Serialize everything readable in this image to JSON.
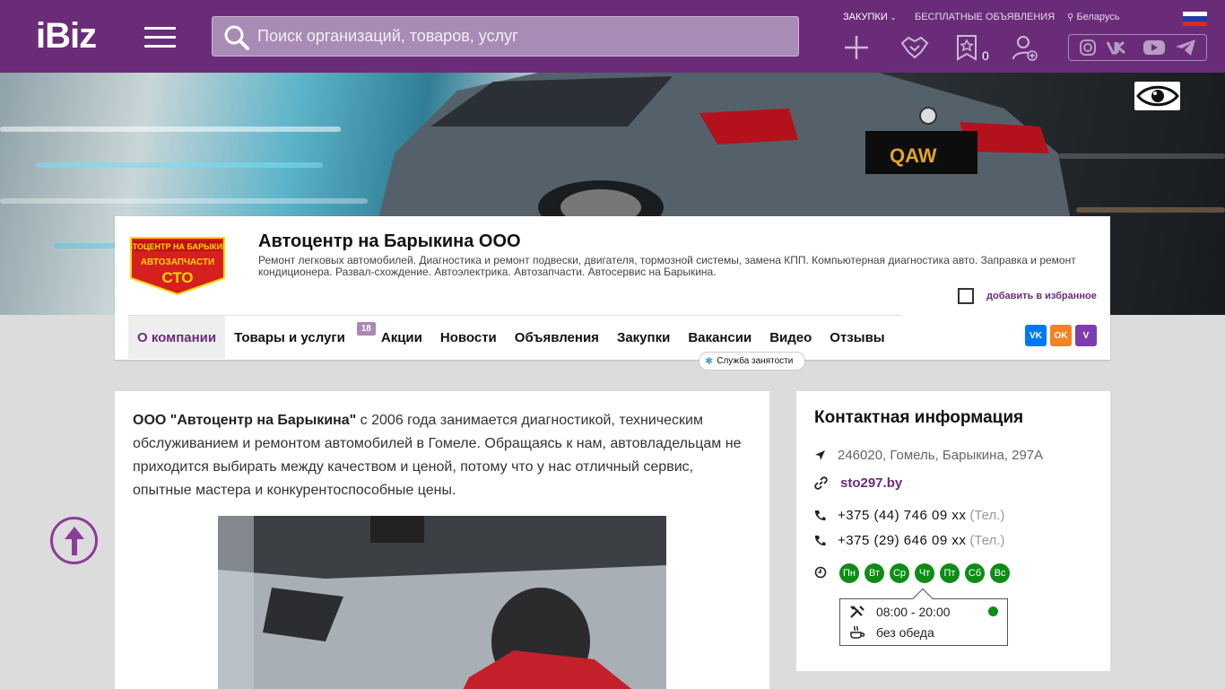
{
  "header": {
    "logo": "iBiz",
    "search_placeholder": "Поиск организаций, товаров, услуг",
    "links": {
      "purchases": "ЗАКУПКИ",
      "free_ads": "БЕСПЛАТНЫЕ ОБЪЯВЛЕНИЯ",
      "region": "Беларусь"
    },
    "favorites_count": "0"
  },
  "company": {
    "logo_lines": [
      "АВТОЦЕНТР НА БАРЫКИНА",
      "АВТОЗАПЧАСТИ",
      "СТО"
    ],
    "title": "Автоцентр на Барыкина ООО",
    "description": "Ремонт легковых автомобилей. Диагностика и ремонт подвески, двигателя, тормозной системы, замена КПП. Компьютерная диагностика авто. Заправка и ремонт кондиционера. Развал-схождение. Автоэлектрика. Автозапчасти. Автосервис на Барыкина.",
    "favorite_label": "добавить в избранное",
    "banner_plate": "QAW"
  },
  "tabs": [
    {
      "label": "О компании"
    },
    {
      "label": "Товары и услуги",
      "badge": "18"
    },
    {
      "label": "Акции"
    },
    {
      "label": "Новости"
    },
    {
      "label": "Объявления"
    },
    {
      "label": "Закупки"
    },
    {
      "label": "Вакансии"
    },
    {
      "label": "Видео"
    },
    {
      "label": "Отзывы"
    }
  ],
  "employment_label": "Служба занятости",
  "share": {
    "vk": "VK",
    "ok": "OK",
    "viber": "V"
  },
  "about": {
    "company_name": "ООО \"Автоцентр на Барыкина\"",
    "text": " с 2006 года занимается диагностикой, техническим обслуживанием и ремонтом автомобилей в Гомеле. Обращаясь к нам, автовладельцам не приходится выбирать между качеством и ценой, потому что у нас отличный сервис, опытные мастера и конкурентоспособные цены."
  },
  "contact": {
    "title": "Контактная информация",
    "address": "246020, Гомель, Барыкина, 297А",
    "website": "sto297.by",
    "phones": [
      {
        "number": "+375 (44) 746 09 xx",
        "type": "(Тел.)"
      },
      {
        "number": "+375 (29) 646 09 xx",
        "type": "(Тел.)"
      }
    ],
    "days": [
      "Пн",
      "Вт",
      "Ср",
      "Чт",
      "Пт",
      "Сб",
      "Вс"
    ],
    "hours": "08:00 - 20:00",
    "lunch": "без обеда"
  },
  "colors": {
    "brand": "#6a2c79",
    "open": "#0e8c16"
  }
}
